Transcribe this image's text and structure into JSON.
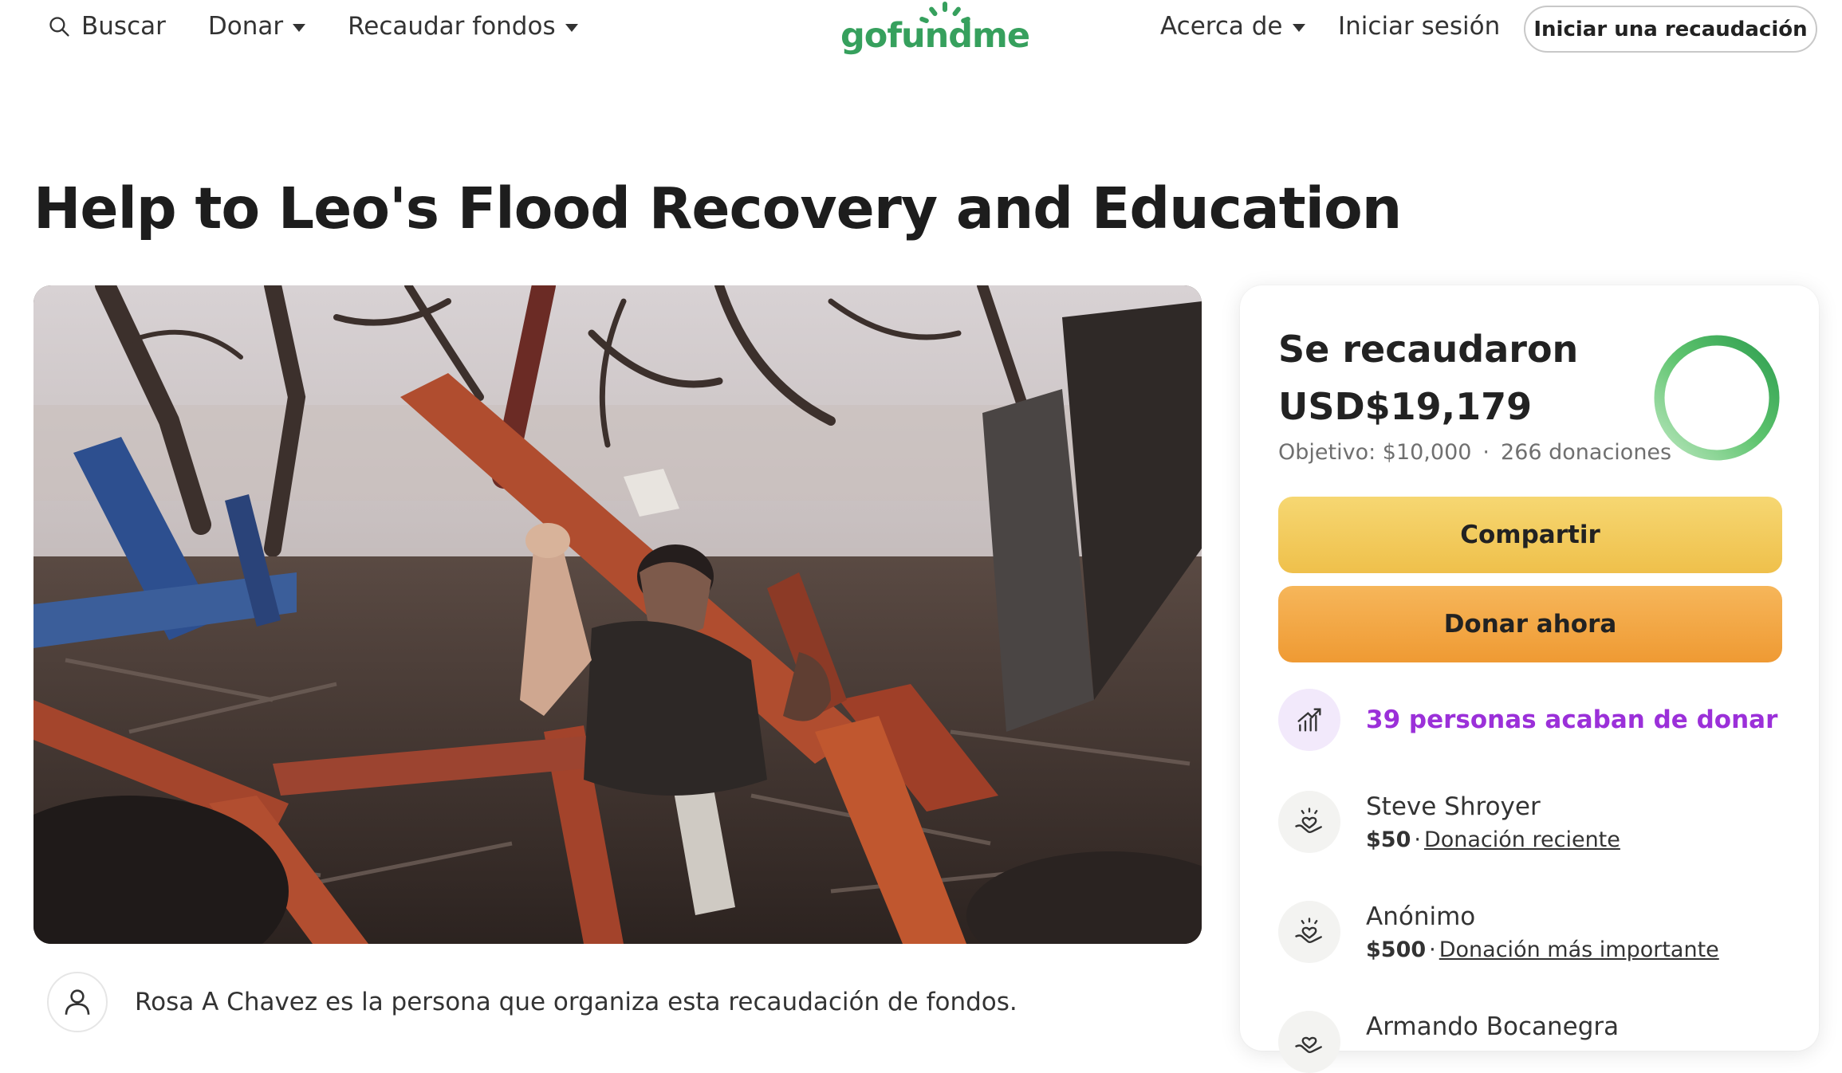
{
  "header": {
    "search_label": "Buscar",
    "donate_label": "Donar",
    "fundraise_label": "Recaudar fondos",
    "logo_text": "gofundme",
    "about_label": "Acerca de",
    "login_label": "Iniciar sesión",
    "start_label": "Iniciar una recaudación"
  },
  "campaign": {
    "title": "Help to Leo's Flood Recovery and Education",
    "organizer_text": "Rosa A Chavez es la persona que organiza esta recaudación de fondos."
  },
  "panel": {
    "raised_label": "Se recaudaron",
    "raised_amount": "USD$19,179",
    "goal_text": "Objetivo: $10,000",
    "dot": "·",
    "donations_text": "266 donaciones",
    "progress_fraction": 1.0,
    "share_label": "Compartir",
    "donate_label": "Donar ahora",
    "recent_text": "39 personas acaban de donar",
    "donors": [
      {
        "name": "Steve Shroyer",
        "amount": "$50",
        "dot": "·",
        "note": "Donación reciente"
      },
      {
        "name": "Anónimo",
        "amount": "$500",
        "dot": "·",
        "note": "Donación más importante"
      },
      {
        "name": "Armando Bocanegra",
        "amount": "",
        "dot": "",
        "note": ""
      }
    ]
  },
  "colors": {
    "brand_green": "#36a05d",
    "share_yellow": "#efc04b",
    "donate_orange": "#ef9a33",
    "recent_purple": "#9b30d9"
  },
  "icons": {
    "search": "search-icon",
    "caret": "caret-down-icon",
    "avatar": "user-icon",
    "trend": "trending-up-icon",
    "donor": "heart-hand-icon"
  }
}
